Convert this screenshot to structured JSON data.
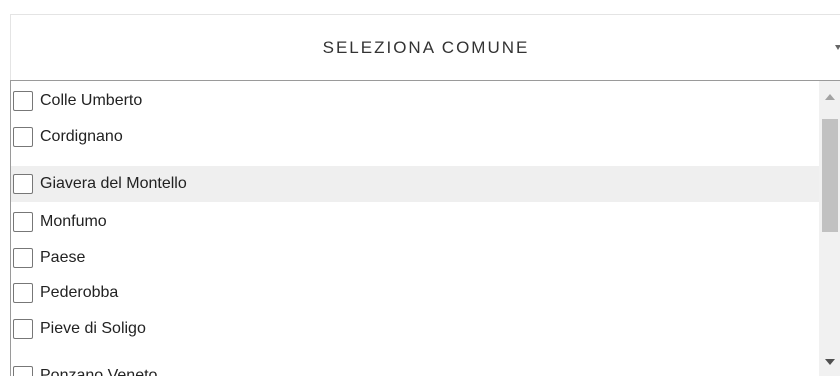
{
  "dropdown": {
    "title": "SELEZIONA COMUNE",
    "caret_icon": "caret-down-icon"
  },
  "list": {
    "items": [
      {
        "label": "Colle Umberto",
        "checked": false,
        "highlighted": false
      },
      {
        "label": "Cordignano",
        "checked": false,
        "highlighted": false
      },
      {
        "label": "Giavera del Montello",
        "checked": false,
        "highlighted": true
      },
      {
        "label": "Monfumo",
        "checked": false,
        "highlighted": false
      },
      {
        "label": "Paese",
        "checked": false,
        "highlighted": false
      },
      {
        "label": "Pederobba",
        "checked": false,
        "highlighted": false
      },
      {
        "label": "Pieve di Soligo",
        "checked": false,
        "highlighted": false
      },
      {
        "label": "Ponzano Veneto",
        "checked": false,
        "highlighted": false
      }
    ]
  },
  "scrollbar": {
    "up_icon": "scroll-up-arrow-icon",
    "down_icon": "scroll-down-arrow-icon"
  },
  "colors": {
    "highlight_row": "#efefef",
    "scroll_thumb": "#c1c1c1",
    "scroll_track": "#f1f1f1",
    "list_border": "#9a9a9a"
  }
}
